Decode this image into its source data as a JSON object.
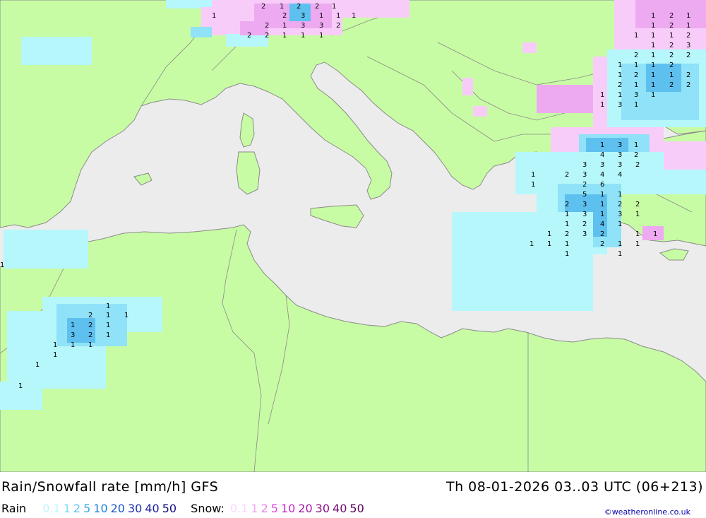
{
  "title": "Rain/Snowfall rate [mm/h] GFS",
  "datetime": "Th 08-01-2026 03..03 UTC (06+213)",
  "credit": "©weatheronline.co.uk",
  "legend": {
    "rain_label": "Rain",
    "rain_values": [
      {
        "v": "0.1",
        "c": "#bdf6fb"
      },
      {
        "v": "1",
        "c": "#85d9ef"
      },
      {
        "v": "2",
        "c": "#5ec6f0"
      },
      {
        "v": "5",
        "c": "#35a8e5"
      },
      {
        "v": "10",
        "c": "#1a7fd4"
      },
      {
        "v": "20",
        "c": "#1858c8"
      },
      {
        "v": "30",
        "c": "#1a30b0"
      },
      {
        "v": "40",
        "c": "#1a1aa0"
      },
      {
        "v": "50",
        "c": "#120c80"
      }
    ],
    "snow_label": "Snow:",
    "snow_values": [
      {
        "v": "0.1",
        "c": "#fbd6fb"
      },
      {
        "v": "1",
        "c": "#f3a8f3"
      },
      {
        "v": "2",
        "c": "#ea7eea"
      },
      {
        "v": "5",
        "c": "#dc48dc"
      },
      {
        "v": "10",
        "c": "#c826c8"
      },
      {
        "v": "20",
        "c": "#a818a8"
      },
      {
        "v": "30",
        "c": "#8c108c"
      },
      {
        "v": "40",
        "c": "#700a70"
      },
      {
        "v": "50",
        "c": "#580058"
      }
    ]
  },
  "colors": {
    "sea": "#ececec",
    "land": "#c8fca4",
    "border": "#8a8a8a",
    "rain_light": "#b6f7fc",
    "rain_mid": "#8fe2f7",
    "rain_heavy": "#5ec0ee",
    "snow_light": "#f8ccf8",
    "snow_mid": "#eeaaf0",
    "snow_heavy": "#e070e8"
  },
  "cell_labels": [
    {
      "id": "alps",
      "values": [
        "2",
        "1",
        "2",
        "2",
        "1",
        "1",
        "2",
        "3",
        "1",
        "1",
        "1",
        "2",
        "1",
        "3",
        "3",
        "2",
        "2",
        "2",
        "1",
        "1",
        "1"
      ]
    },
    {
      "id": "black-sea",
      "values": [
        "1",
        "2",
        "1",
        "1",
        "2",
        "1",
        "1",
        "1",
        "1",
        "2",
        "1",
        "2",
        "3",
        "2",
        "1",
        "2",
        "2",
        "1",
        "1",
        "1",
        "2",
        "1",
        "2",
        "1",
        "1",
        "2",
        "2",
        "1",
        "1",
        "2",
        "2",
        "1",
        "1",
        "3",
        "1",
        "1",
        "3",
        "1"
      ]
    },
    {
      "id": "aegean",
      "values": [
        "1",
        "3",
        "1",
        "4",
        "3",
        "2",
        "3",
        "3",
        "3",
        "2",
        "1",
        "2",
        "3",
        "4",
        "4",
        "1",
        "2",
        "6",
        "5",
        "1",
        "1",
        "2",
        "3",
        "1",
        "2",
        "2",
        "1",
        "3",
        "1",
        "3",
        "1",
        "1",
        "2",
        "4",
        "1",
        "1",
        "2",
        "3",
        "2",
        "1",
        "1",
        "1",
        "1",
        "1",
        "2",
        "1",
        "1",
        "1",
        "1",
        "1"
      ]
    },
    {
      "id": "atlas",
      "values": [
        "1",
        "2",
        "1",
        "1",
        "1",
        "2",
        "1",
        "3",
        "2",
        "1",
        "1",
        "1",
        "1",
        "1",
        "1",
        "1"
      ]
    }
  ]
}
